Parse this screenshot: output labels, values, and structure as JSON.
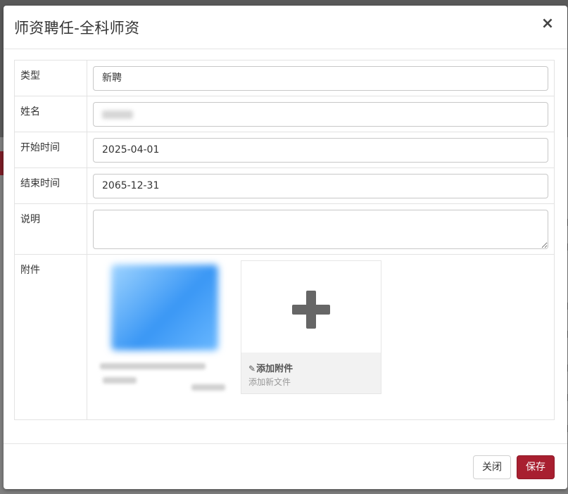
{
  "modal": {
    "title": "师资聘任-全科师资",
    "close_icon": "close-icon"
  },
  "form": {
    "type_label": "类型",
    "type_value": "新聘",
    "name_label": "姓名",
    "start_label": "开始时间",
    "start_value": "2025-04-01",
    "end_label": "结束时间",
    "end_value": "2065-12-31",
    "desc_label": "说明",
    "desc_value": "",
    "attach_label": "附件"
  },
  "attachments": {
    "add_title": "添加附件",
    "add_subtitle": "添加新文件",
    "add_icon": "plus-icon",
    "clip_icon": "paperclip-icon"
  },
  "footer": {
    "close_label": "关闭",
    "save_label": "保存"
  },
  "colors": {
    "primary": "#a81f30",
    "border": "#e3e3e3"
  }
}
